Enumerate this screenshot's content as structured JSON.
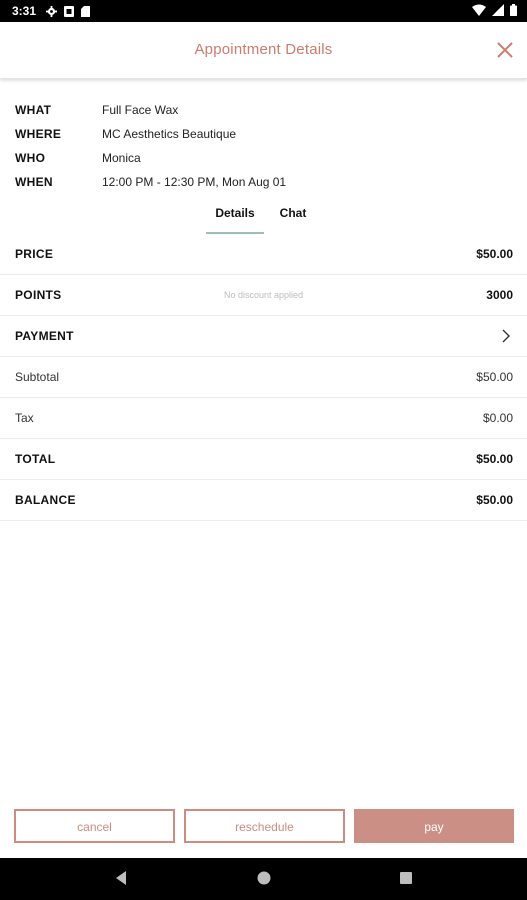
{
  "status_bar": {
    "time": "3:31",
    "icons_left": [
      "settings-icon",
      "sim-icon",
      "sd-card-icon"
    ],
    "icons_right": [
      "wifi-icon",
      "signal-icon",
      "battery-icon"
    ]
  },
  "header": {
    "title": "Appointment Details",
    "close_icon": "close-icon",
    "accent_color": "#cd7c6e"
  },
  "info": [
    {
      "key": "WHAT",
      "value": "Full Face Wax"
    },
    {
      "key": "WHERE",
      "value": "MC Aesthetics Beautique"
    },
    {
      "key": "WHO",
      "value": "Monica"
    },
    {
      "key": "WHEN",
      "value": "12:00 PM - 12:30 PM, Mon Aug 01"
    }
  ],
  "tabs": {
    "details": "Details",
    "chat": "Chat",
    "active": "details",
    "underline_color": "#9dbfb4"
  },
  "items": {
    "price": {
      "label": "PRICE",
      "value": "$50.00"
    },
    "points": {
      "label": "POINTS",
      "note": "No discount applied",
      "value": "3000"
    },
    "payment": {
      "label": "PAYMENT",
      "icon": "chevron-right-icon"
    },
    "subtotal": {
      "label": "Subtotal",
      "value": "$50.00"
    },
    "tax": {
      "label": "Tax",
      "value": "$0.00"
    },
    "total": {
      "label": "TOTAL",
      "value": "$50.00"
    },
    "balance": {
      "label": "BALANCE",
      "value": "$50.00"
    }
  },
  "buttons": {
    "cancel": "cancel",
    "reschedule": "reschedule",
    "pay": "pay",
    "outline_color": "#cd8c82",
    "pay_color": "#cb8f86"
  },
  "nav_bar": {
    "icons": [
      "back-icon",
      "home-icon",
      "recents-icon"
    ]
  }
}
